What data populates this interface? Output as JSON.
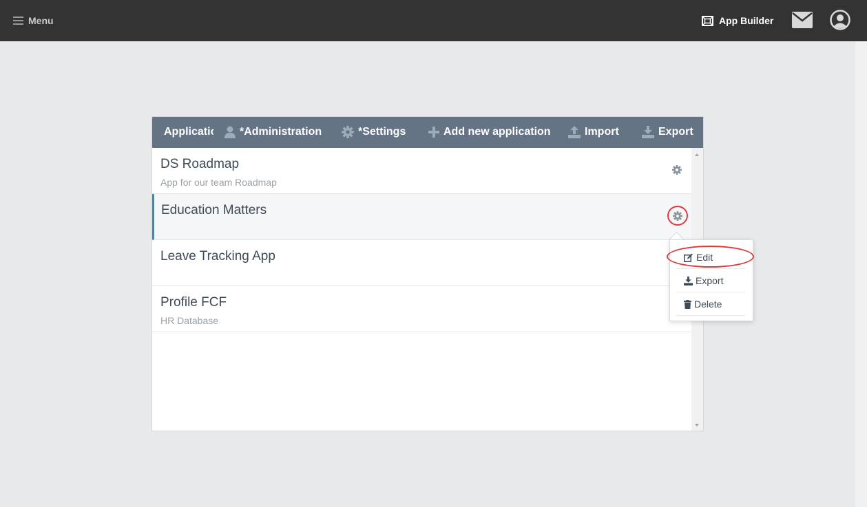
{
  "topbar": {
    "menu_label": "Menu",
    "app_builder_label": "App Builder",
    "mail_icon": "envelope-icon",
    "user_icon": "user-circle-icon"
  },
  "panel": {
    "title": "Applications",
    "buttons": [
      {
        "label": "*Administration",
        "icon": "user-icon"
      },
      {
        "label": "*Settings",
        "icon": "gear-icon"
      },
      {
        "label": "Add new application",
        "icon": "plus-icon"
      },
      {
        "label": "Import",
        "icon": "upload-icon"
      },
      {
        "label": "Export",
        "icon": "download-icon"
      }
    ]
  },
  "apps": [
    {
      "title": "DS Roadmap",
      "description": "App for our team Roadmap"
    },
    {
      "title": "Education Matters",
      "description": ""
    },
    {
      "title": "Leave Tracking App",
      "description": ""
    },
    {
      "title": "Profile FCF",
      "description": "HR Database"
    }
  ],
  "dropdown": {
    "items": [
      {
        "label": "Edit",
        "icon": "edit-icon"
      },
      {
        "label": "Export",
        "icon": "download-icon"
      },
      {
        "label": "Delete",
        "icon": "trash-icon"
      }
    ]
  },
  "colors": {
    "topbar": "#333333",
    "panel_header": "#647485",
    "active_accent": "#1a9bb5",
    "annotation": "#e0393e",
    "page_bg": "#e8e9eb"
  }
}
